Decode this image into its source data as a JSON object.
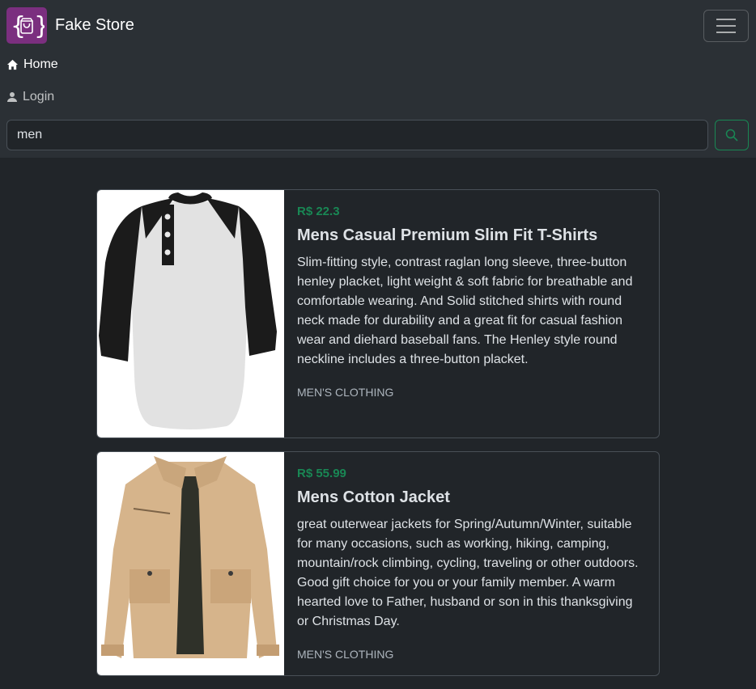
{
  "brand": {
    "name": "Fake Store",
    "logo_color": "#7b2f7f"
  },
  "nav": {
    "items": [
      {
        "label": "Home",
        "icon": "home-icon",
        "active": true
      },
      {
        "label": "Login",
        "icon": "user-icon",
        "active": false
      }
    ]
  },
  "search": {
    "value": "men",
    "button_icon": "search-icon",
    "button_color": "#198754"
  },
  "products": [
    {
      "price": "R$ 22.3",
      "title": "Mens Casual Premium Slim Fit T-Shirts",
      "description": "Slim-fitting style, contrast raglan long sleeve, three-button henley placket, light weight & soft fabric for breathable and comfortable wearing. And Solid stitched shirts with round neck made for durability and a great fit for casual fashion wear and diehard baseball fans. The Henley style round neckline includes a three-button placket.",
      "category": "men's clothing",
      "image": "raglan-henley-shirt-image"
    },
    {
      "price": "R$ 55.99",
      "title": "Mens Cotton Jacket",
      "description": "great outerwear jackets for Spring/Autumn/Winter, suitable for many occasions, such as working, hiking, camping, mountain/rock climbing, cycling, traveling or other outdoors. Good gift choice for you or your family member. A warm hearted love to Father, husband or son in this thanksgiving or Christmas Day.",
      "category": "men's clothing",
      "image": "khaki-cotton-jacket-image"
    }
  ],
  "colors": {
    "background": "#212529",
    "navbar": "#2b3035",
    "price": "#198754",
    "border": "#495057"
  }
}
